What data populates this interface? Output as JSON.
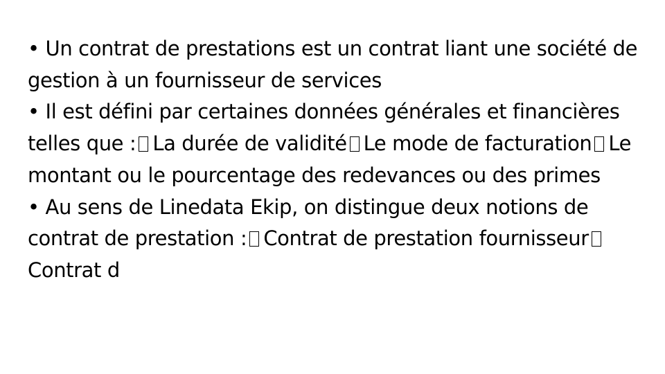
{
  "paragraphs": [
    {
      "bullet": "•",
      "segments": [
        "Un contrat de prestations est un contrat liant une société de gestion à un fournisseur de services"
      ]
    },
    {
      "bullet": "•",
      "segments": [
        "Il est défini par certaines données générales et financières telles que :",
        "La durée de validité",
        "Le mode de facturation",
        "Le montant ou le pourcentage des redevances ou des primes"
      ]
    },
    {
      "bullet": "•",
      "segments": [
        "Au sens de Linedata Ekip, on distingue deux notions de contrat de prestation :",
        "Contrat de prestation fournisseur",
        "Contrat d"
      ]
    }
  ]
}
